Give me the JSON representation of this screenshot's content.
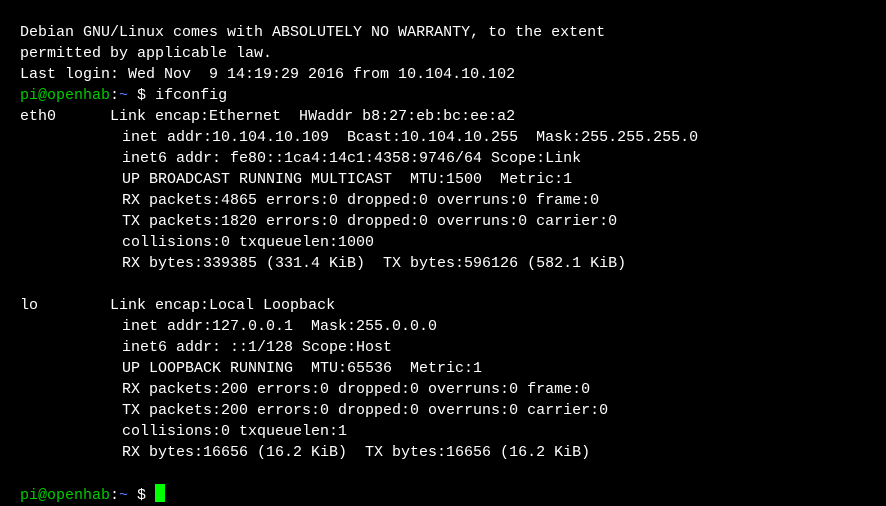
{
  "motd": {
    "line1": "Debian GNU/Linux comes with ABSOLUTELY NO WARRANTY, to the extent",
    "line2": "permitted by applicable law.",
    "lastLogin": "Last login: Wed Nov  9 14:19:29 2016 from 10.104.10.102"
  },
  "prompt": {
    "userhost": "pi@openhab",
    "colon": ":",
    "path": "~ ",
    "symbol": "$ "
  },
  "command1": "ifconfig",
  "ifconfig": {
    "eth0": {
      "name": "eth0",
      "pad": "      ",
      "l1": "Link encap:Ethernet  HWaddr b8:27:eb:bc:ee:a2",
      "l2": "inet addr:10.104.10.109  Bcast:10.104.10.255  Mask:255.255.255.0",
      "l3": "inet6 addr: fe80::1ca4:14c1:4358:9746/64 Scope:Link",
      "l4": "UP BROADCAST RUNNING MULTICAST  MTU:1500  Metric:1",
      "l5": "RX packets:4865 errors:0 dropped:0 overruns:0 frame:0",
      "l6": "TX packets:1820 errors:0 dropped:0 overruns:0 carrier:0",
      "l7": "collisions:0 txqueuelen:1000",
      "l8": "RX bytes:339385 (331.4 KiB)  TX bytes:596126 (582.1 KiB)"
    },
    "lo": {
      "name": "lo",
      "pad": "        ",
      "l1": "Link encap:Local Loopback",
      "l2": "inet addr:127.0.0.1  Mask:255.0.0.0",
      "l3": "inet6 addr: ::1/128 Scope:Host",
      "l4": "UP LOOPBACK RUNNING  MTU:65536  Metric:1",
      "l5": "RX packets:200 errors:0 dropped:0 overruns:0 frame:0",
      "l6": "TX packets:200 errors:0 dropped:0 overruns:0 carrier:0",
      "l7": "collisions:0 txqueuelen:1",
      "l8": "RX bytes:16656 (16.2 KiB)  TX bytes:16656 (16.2 KiB)"
    }
  }
}
